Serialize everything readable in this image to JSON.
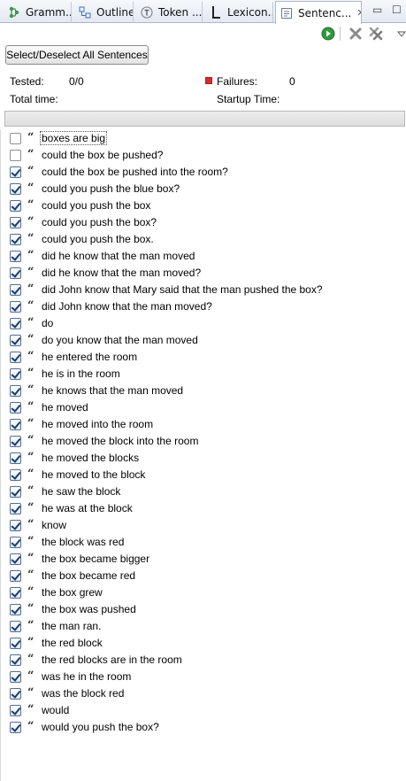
{
  "tabs": [
    {
      "label": "Gramm...",
      "icon": "grammar-icon"
    },
    {
      "label": "Outline",
      "icon": "outline-icon"
    },
    {
      "label": "Token ...",
      "icon": "token-icon"
    },
    {
      "label": "Lexicon...",
      "icon": "lexicon-icon"
    },
    {
      "label": "Sentenc...",
      "icon": "sentences-icon",
      "active": true,
      "close": "✕"
    }
  ],
  "window_controls": {
    "minimize": "▭",
    "maximize": "☐"
  },
  "toolbar": {
    "run": "run-icon",
    "remove": "remove-icon",
    "remove_all": "remove-all-icon",
    "menu": "view-menu-icon"
  },
  "select_button_label": "Select/Deselect All Sentences",
  "stats": {
    "tested_label": "Tested:",
    "tested_value": "0/0",
    "failures_label": "Failures:",
    "failures_value": "0",
    "total_time_label": "Total time:",
    "startup_time_label": "Startup Time:"
  },
  "colors": {
    "failure": "#d62d2d",
    "run_green": "#2f9a3c"
  },
  "sentences": [
    {
      "text": "boxes are big",
      "checked": false,
      "focused": true
    },
    {
      "text": "could the box be pushed?",
      "checked": false
    },
    {
      "text": "could the box be pushed into the room?",
      "checked": true
    },
    {
      "text": "could you push the blue box?",
      "checked": true
    },
    {
      "text": "could you push the box",
      "checked": true
    },
    {
      "text": "could you push the box?",
      "checked": true
    },
    {
      "text": "could you push the box.",
      "checked": true
    },
    {
      "text": "did he know that the man moved",
      "checked": true
    },
    {
      "text": "did he know that the man moved?",
      "checked": true
    },
    {
      "text": "did John know that Mary said that the man pushed the box?",
      "checked": true
    },
    {
      "text": "did John know that the man moved?",
      "checked": true
    },
    {
      "text": "do",
      "checked": true
    },
    {
      "text": "do you know that the man moved",
      "checked": true
    },
    {
      "text": "he entered the room",
      "checked": true
    },
    {
      "text": "he is in the room",
      "checked": true
    },
    {
      "text": "he knows that the man moved",
      "checked": true
    },
    {
      "text": "he moved",
      "checked": true
    },
    {
      "text": "he moved into the room",
      "checked": true
    },
    {
      "text": "he moved the block into the room",
      "checked": true
    },
    {
      "text": "he moved the blocks",
      "checked": true
    },
    {
      "text": "he moved to the block",
      "checked": true
    },
    {
      "text": "he saw the block",
      "checked": true
    },
    {
      "text": "he was at the block",
      "checked": true
    },
    {
      "text": "know",
      "checked": true
    },
    {
      "text": "the block was red",
      "checked": true
    },
    {
      "text": "the box became bigger",
      "checked": true
    },
    {
      "text": "the box became red",
      "checked": true
    },
    {
      "text": "the box grew",
      "checked": true
    },
    {
      "text": "the box was pushed",
      "checked": true
    },
    {
      "text": "the man ran.",
      "checked": true
    },
    {
      "text": "the red block",
      "checked": true
    },
    {
      "text": "the red blocks are in the room",
      "checked": true
    },
    {
      "text": "was he in the room",
      "checked": true
    },
    {
      "text": "was the block red",
      "checked": true
    },
    {
      "text": "would",
      "checked": true
    },
    {
      "text": "would you push the box?",
      "checked": true
    }
  ]
}
